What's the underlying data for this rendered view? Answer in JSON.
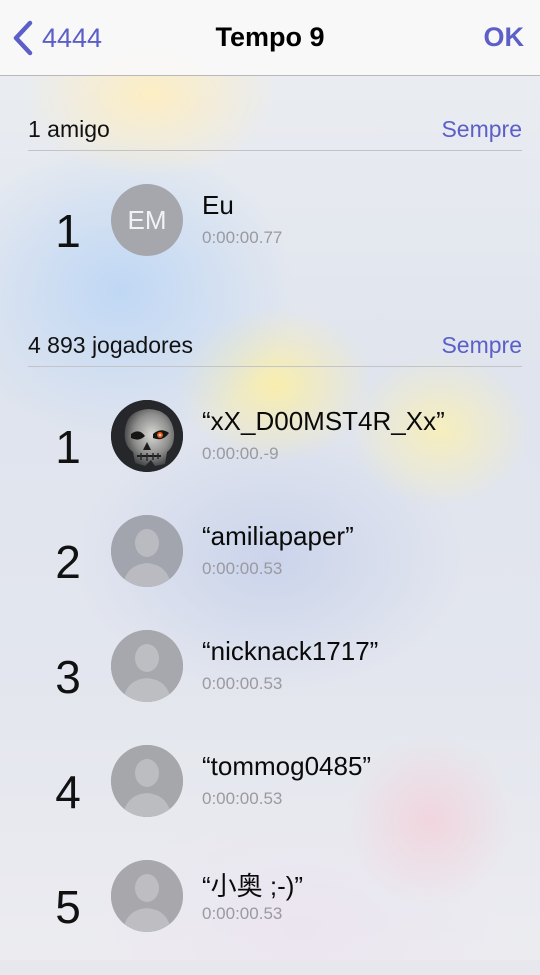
{
  "nav": {
    "back_label": "4444",
    "title": "Tempo 9",
    "ok_label": "OK",
    "accent_color": "#5b5fc7"
  },
  "friends": {
    "title": "1 amigo",
    "filter": "Sempre",
    "rows": [
      {
        "rank": "1",
        "initials": "EM",
        "name": "Eu",
        "time": "0:00:00.77",
        "avatar": "initials"
      }
    ]
  },
  "players": {
    "title": "4 893 jogadores",
    "filter": "Sempre",
    "rows": [
      {
        "rank": "1",
        "name": "“xX_D00MST4R_Xx”",
        "time": "0:00:00.-9",
        "avatar": "skull-avatar"
      },
      {
        "rank": "2",
        "name": "“amiliapaper”",
        "time": "0:00:00.53",
        "avatar": "person-placeholder"
      },
      {
        "rank": "3",
        "name": "“nicknack1717”",
        "time": "0:00:00.53",
        "avatar": "person-placeholder"
      },
      {
        "rank": "4",
        "name": "“tommog0485”",
        "time": "0:00:00.53",
        "avatar": "person-placeholder"
      },
      {
        "rank": "5",
        "name": "“小奥 ;-)”",
        "time": "0:00:00.53",
        "avatar": "person-placeholder"
      }
    ]
  }
}
